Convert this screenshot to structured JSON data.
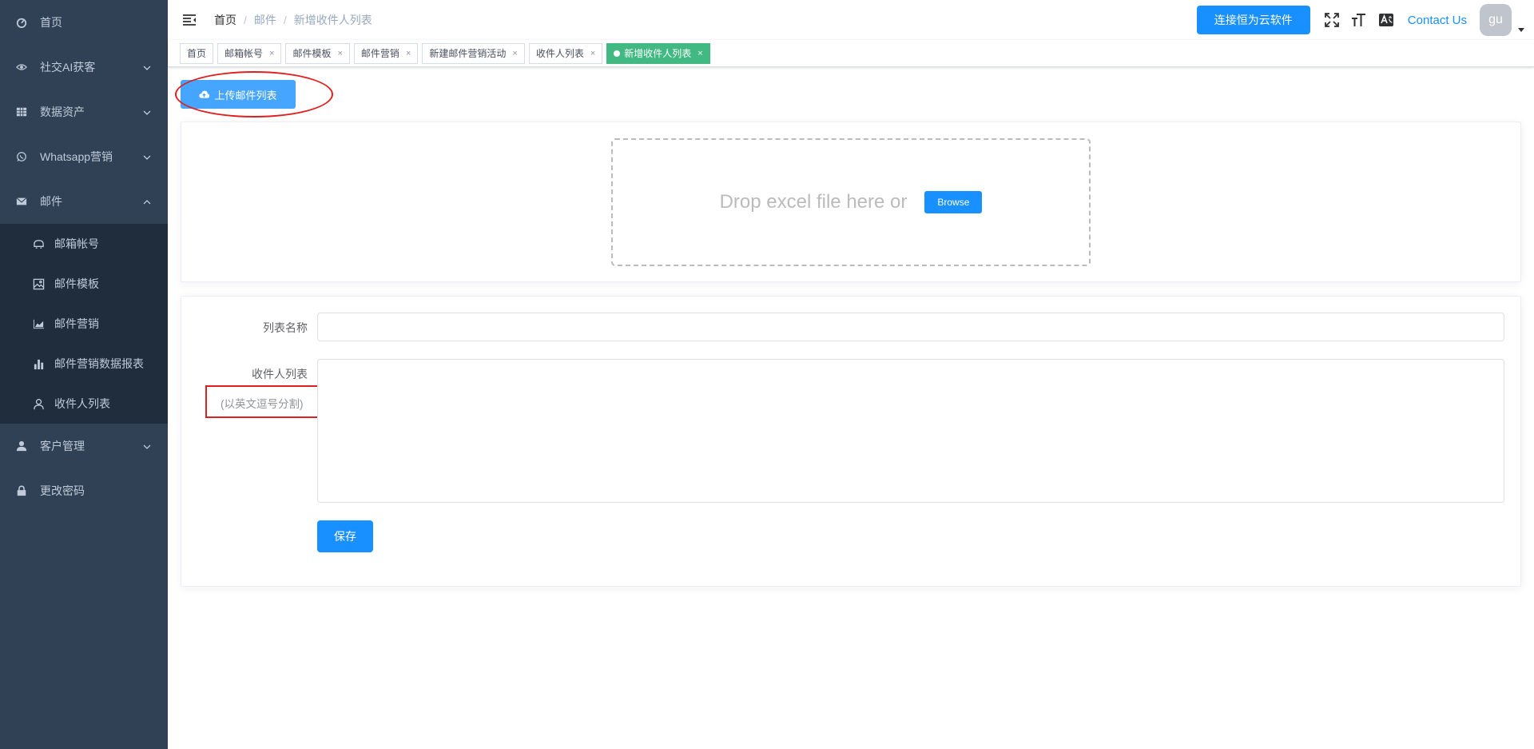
{
  "sidebar": {
    "items": [
      {
        "label": "首页"
      },
      {
        "label": "社交AI获客"
      },
      {
        "label": "数据资产"
      },
      {
        "label": "Whatsapp营销"
      },
      {
        "label": "邮件"
      },
      {
        "label": "客户管理"
      },
      {
        "label": "更改密码"
      }
    ],
    "mail_submenu": [
      {
        "label": "邮箱帐号"
      },
      {
        "label": "邮件模板"
      },
      {
        "label": "邮件营销"
      },
      {
        "label": "邮件营销数据报表"
      },
      {
        "label": "收件人列表"
      }
    ]
  },
  "header": {
    "breadcrumb": [
      "首页",
      "邮件",
      "新增收件人列表"
    ],
    "cloud_button": "连接恒为云软件",
    "contact": "Contact Us",
    "avatar_text": "gu"
  },
  "tags": [
    {
      "label": "首页"
    },
    {
      "label": "邮箱帐号"
    },
    {
      "label": "邮件模板"
    },
    {
      "label": "邮件营销"
    },
    {
      "label": "新建邮件营销活动"
    },
    {
      "label": "收件人列表"
    },
    {
      "label": "新增收件人列表"
    }
  ],
  "tag_close": "×",
  "upload": {
    "button_label": "上传邮件列表",
    "drop_text": "Drop excel file here or",
    "browse_label": "Browse"
  },
  "form": {
    "list_name_label": "列表名称",
    "list_name_value": "",
    "recipients_label": "收件人列表",
    "recipients_hint": "(以英文逗号分割)",
    "recipients_value": "",
    "save_label": "保存"
  },
  "colors": {
    "sidebar_bg": "#304156",
    "submenu_bg": "#1f2d3d",
    "primary": "#1890ff",
    "active_tag": "#42b983",
    "annotation_red": "#e02020"
  }
}
